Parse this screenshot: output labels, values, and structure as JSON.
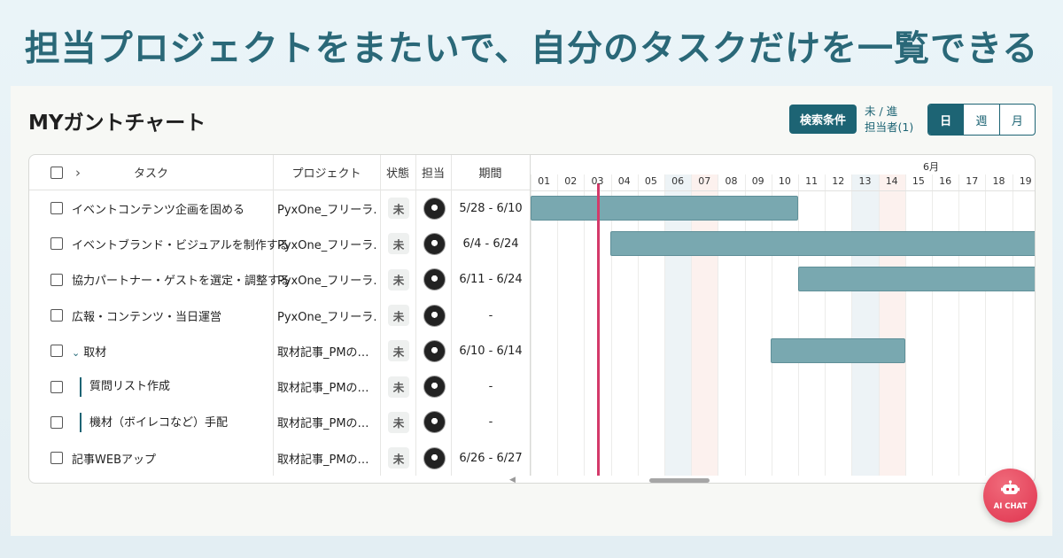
{
  "headline": "担当プロジェクトをまたいで、自分のタスクだけを一覧できる",
  "page_title": "MYガントチャート",
  "toolbar": {
    "search_label": "検索条件",
    "filter_line1": "未 / 進",
    "filter_line2": "担当者(1)",
    "views": [
      "日",
      "週",
      "月"
    ],
    "active_view": "日"
  },
  "table": {
    "columns": [
      "タスク",
      "プロジェクト",
      "状態",
      "担当",
      "期間"
    ],
    "rows": [
      {
        "task": "イベントコンテンツ企画を固める",
        "project": "PyxOne_フリーラ…",
        "status": "未",
        "period": "5/28 - 6/10"
      },
      {
        "task": "イベントブランド・ビジュアルを制作する",
        "project": "PyxOne_フリーラ…",
        "status": "未",
        "period": "6/4 - 6/24"
      },
      {
        "task": "協力パートナー・ゲストを選定・調整する",
        "project": "PyxOne_フリーラ…",
        "status": "未",
        "period": "6/11 - 6/24"
      },
      {
        "task": "広報・コンテンツ・当日運営",
        "project": "PyxOne_フリーラ…",
        "status": "未",
        "period": "-"
      },
      {
        "task": "取材",
        "project": "取材記事_PMの…",
        "status": "未",
        "period": "6/10 - 6/14"
      },
      {
        "task": "質問リスト作成",
        "project": "取材記事_PMの…",
        "status": "未",
        "period": "-"
      },
      {
        "task": "機材（ボイレコなど）手配",
        "project": "取材記事_PMの…",
        "status": "未",
        "period": "-"
      },
      {
        "task": "記事WEBアップ",
        "project": "取材記事_PMの…",
        "status": "未",
        "period": "6/26 - 6/27"
      }
    ]
  },
  "gantt": {
    "month_label": "6月",
    "days": [
      "01",
      "02",
      "03",
      "04",
      "05",
      "06",
      "07",
      "08",
      "09",
      "10",
      "11",
      "12",
      "13",
      "14",
      "15",
      "16",
      "17",
      "18",
      "19"
    ],
    "today": "03",
    "saturdays": [
      "06",
      "13"
    ],
    "sundays": [
      "07",
      "14"
    ]
  },
  "ai_chat_label": "AI CHAT",
  "colors": {
    "accent": "#1d6474",
    "bar": "#79a8b0",
    "today": "#d43a6a",
    "chat": "#e0344f"
  }
}
